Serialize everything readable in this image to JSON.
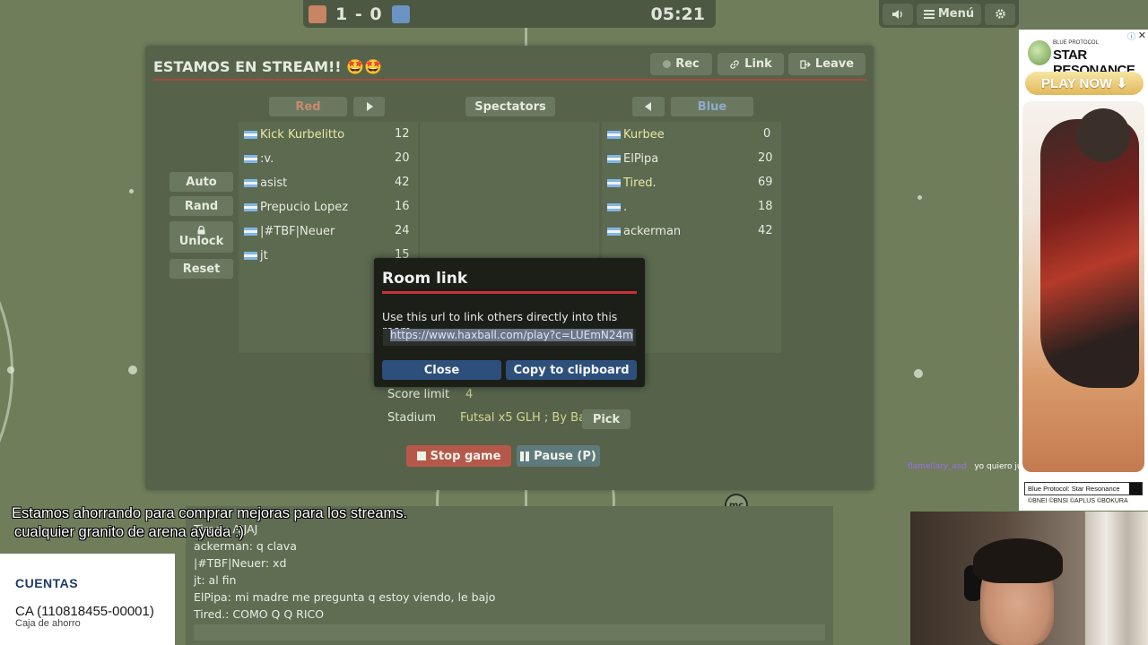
{
  "scoreboard": {
    "red_color": "#c98463",
    "blue_color": "#6b93c4",
    "score": "1 - 0",
    "time": "05:21"
  },
  "topright": {
    "sound_icon": "speaker-icon",
    "menu_label": "Menú",
    "settings_icon": "gear-icon"
  },
  "room": {
    "title": "ESTAMOS EN STREAM!! 🤩🤩",
    "rec_label": "Rec",
    "link_label": "Link",
    "leave_label": "Leave",
    "red_label": "Red",
    "spectators_label": "Spectators",
    "blue_label": "Blue",
    "auto_label": "Auto",
    "rand_label": "Rand",
    "unlock_label": "Unlock",
    "reset_label": "Reset",
    "red_players": [
      {
        "name": "Kick Kurbelitto",
        "score": "12"
      },
      {
        "name": ":v.",
        "score": "20"
      },
      {
        "name": "asist",
        "score": "42"
      },
      {
        "name": "Prepucio Lopez",
        "score": "16"
      },
      {
        "name": "|#TBF|Neuer",
        "score": "24"
      },
      {
        "name": "jt",
        "score": "15"
      }
    ],
    "blue_players": [
      {
        "name": "Kurbee",
        "score": "0"
      },
      {
        "name": "ElPipa",
        "score": "20"
      },
      {
        "name": "Tired.",
        "score": "69"
      },
      {
        "name": ".",
        "score": "18"
      },
      {
        "name": "ackerman",
        "score": "42"
      }
    ],
    "score_limit_label": "Score limit",
    "score_limit_value": "4",
    "stadium_label": "Stadium",
    "stadium_value": "Futsal x5 GLH ; By Ba...",
    "pick_label": "Pick",
    "stop_label": "Stop game",
    "pause_label": "Pause (P)"
  },
  "dialog": {
    "title": "Room link",
    "text": "Use this url to link others directly into this room.",
    "url": "https://www.haxball.com/play?c=LUEmN24m",
    "close_label": "Close",
    "copy_label": "Copy to clipboard"
  },
  "chat": {
    "messages": [
      "Tired.: AJJAJ",
      "ackerman: q clava",
      "|#TBF|Neuer: xd",
      "jt: al fin",
      "ElPipa: mi madre me pregunta q estoy viendo, le bajo",
      "Tired.: COMO Q Q RICO"
    ]
  },
  "overlay": {
    "line1": "Estamos ahorrando para comprar mejoras para los streams.",
    "line2": "cualquier granito de arena ayuda :)",
    "cuentas_title": "CUENTAS",
    "cuentas_account": "CA (110818455-00001)",
    "cuentas_type": "Caja de ahorro",
    "twitch_user": "flamellary_asd",
    "twitch_msg": "yo quiero juga"
  },
  "ad": {
    "brand_small": "BLUE PROTOCOL",
    "brand": "STAR RESONANCE",
    "cta": "PLAY NOW ⬇",
    "caption": "Blue Protocol: Star Resonance",
    "footer": "©BNEI ©BNSI ©APLUS ©BOKURA"
  }
}
